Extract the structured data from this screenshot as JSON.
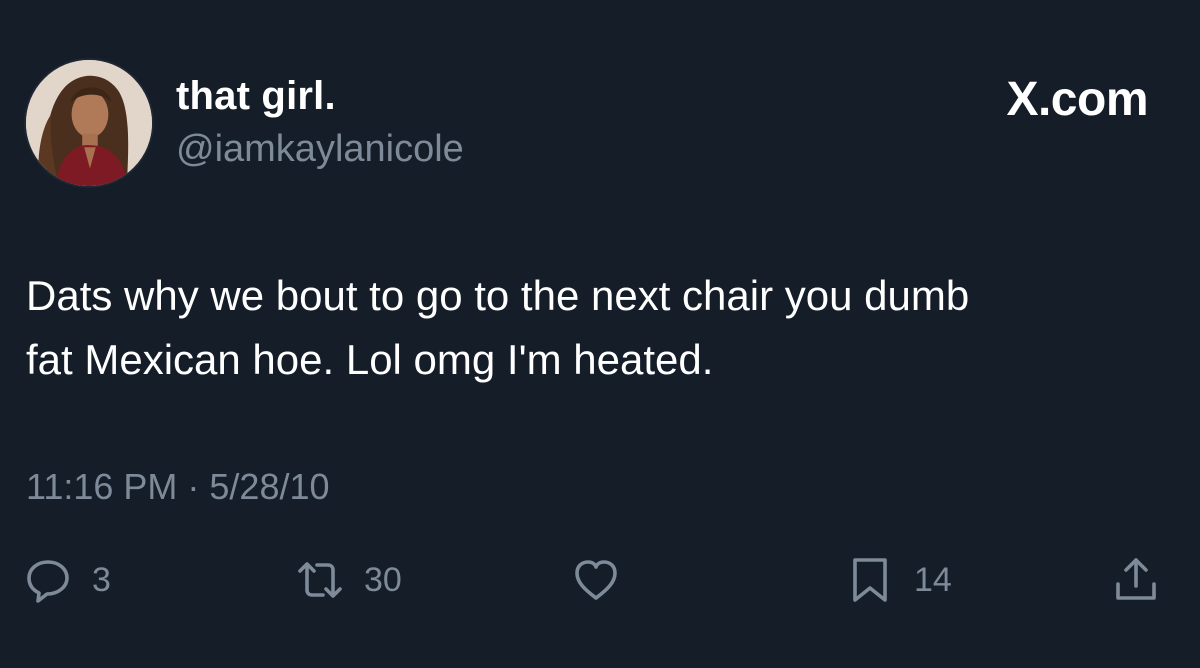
{
  "tweet": {
    "display_name": "that girl.",
    "handle": "@iamkaylanicole",
    "brand": "X.com",
    "text_line1": "Dats why we bout to go to the next chair you dumb",
    "text_line2": "fat Mexican hoe. Lol omg I'm heated.",
    "timestamp": "11:16 PM · 5/28/10"
  },
  "actions": {
    "reply": {
      "icon": "reply-icon",
      "count": "3"
    },
    "retweet": {
      "icon": "retweet-icon",
      "count": "30"
    },
    "like": {
      "icon": "heart-icon"
    },
    "bookmark": {
      "icon": "bookmark-icon",
      "count": "14"
    },
    "share": {
      "icon": "share-icon"
    }
  },
  "colors": {
    "background": "#151d28",
    "primary_text": "#ffffff",
    "secondary_text": "#7d8a98"
  }
}
